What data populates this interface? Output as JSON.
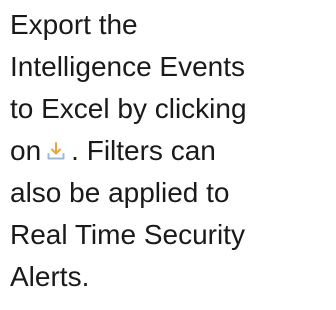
{
  "instruction": {
    "line1": "Export the",
    "line2": "Intelligence Events",
    "line3": "to Excel by clicking",
    "line4_before_icon": "on",
    "line4_after_icon": ". Filters can",
    "line5": "also be applied to",
    "line6": "Real Time Security",
    "line7": "Alerts."
  },
  "icon": {
    "name": "download-icon",
    "color": "#e8a33d",
    "tray_color": "#9fb8d6"
  }
}
